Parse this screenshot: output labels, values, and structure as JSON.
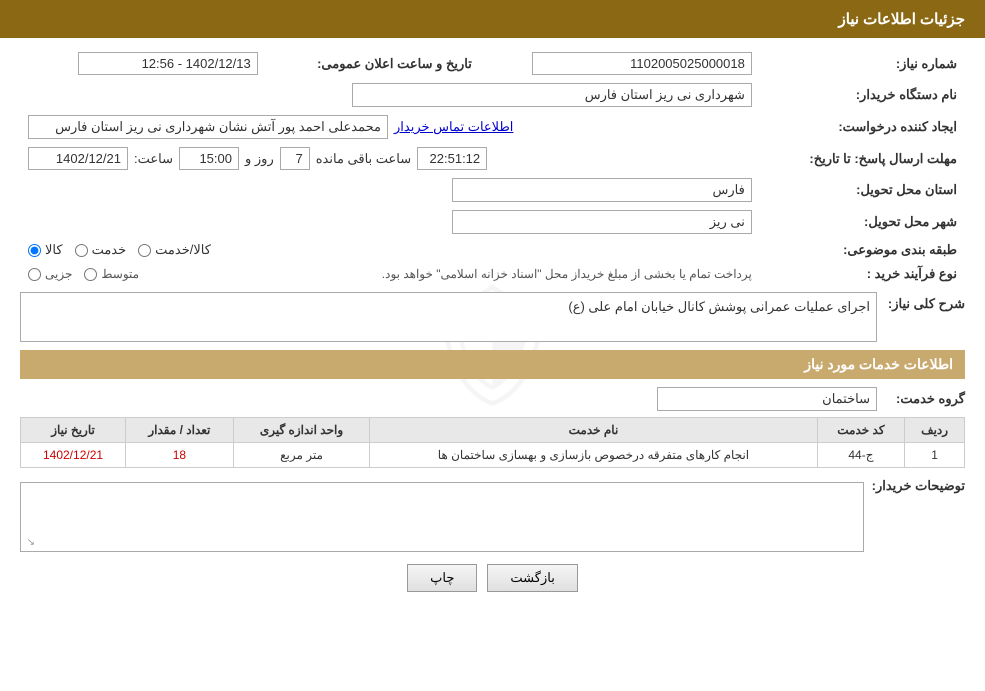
{
  "header": {
    "title": "جزئیات اطلاعات نیاز"
  },
  "info_section": {
    "need_number_label": "شماره نیاز:",
    "need_number_value": "1102005025000018",
    "announcement_label": "تاریخ و ساعت اعلان عمومی:",
    "announcement_value": "1402/12/13 - 12:56",
    "buyer_org_label": "نام دستگاه خریدار:",
    "buyer_org_value": "شهرداری نی ریز استان فارس",
    "creator_label": "ایجاد کننده درخواست:",
    "creator_value": "محمدعلی احمد پور آتش نشان شهرداری نی ریز استان فارس",
    "creator_link": "اطلاعات تماس خریدار",
    "response_deadline_label": "مهلت ارسال پاسخ: تا تاریخ:",
    "response_date": "1402/12/21",
    "response_time_label": "ساعت:",
    "response_time": "15:00",
    "response_days_label": "روز و",
    "response_days": "7",
    "response_remaining_label": "ساعت باقی مانده",
    "response_remaining": "22:51:12",
    "province_label": "استان محل تحویل:",
    "province_value": "فارس",
    "city_label": "شهر محل تحویل:",
    "city_value": "نی ریز",
    "category_label": "طبقه بندی موضوعی:",
    "category_options": [
      "کالا",
      "خدمت",
      "کالا/خدمت"
    ],
    "category_selected": "کالا",
    "process_label": "نوع فرآیند خرید :",
    "process_note": "پرداخت تمام یا بخشی از مبلغ خریداز محل \"اسناد خزانه اسلامی\" خواهد بود.",
    "process_options": [
      "جزیی",
      "متوسط"
    ]
  },
  "description_section": {
    "title": "شرح کلی نیاز:",
    "description_text": "اجرای عملیات عمرانی پوشش کانال خیابان امام علی (ع)"
  },
  "services_section": {
    "title": "اطلاعات خدمات مورد نیاز",
    "group_label": "گروه خدمت:",
    "group_value": "ساختمان",
    "table_headers": [
      "ردیف",
      "کد خدمت",
      "نام خدمت",
      "واحد اندازه گیری",
      "تعداد / مقدار",
      "تاریخ نیاز"
    ],
    "table_rows": [
      {
        "row": "1",
        "code": "ج-44",
        "name": "انجام کارهای متفرقه درخصوص بازسازی و بهسازی ساختمان ها",
        "unit": "متر مربع",
        "quantity": "18",
        "date": "1402/12/21"
      }
    ]
  },
  "buyer_notes": {
    "label": "توضیحات خریدار:",
    "value": ""
  },
  "buttons": {
    "print_label": "چاپ",
    "back_label": "بازگشت"
  }
}
